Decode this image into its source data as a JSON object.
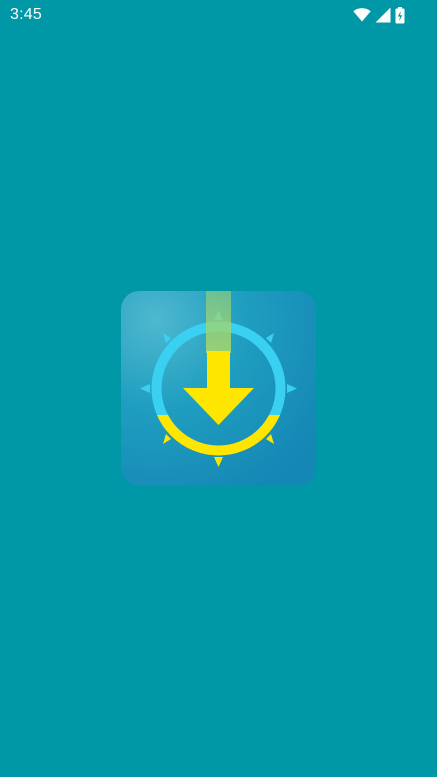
{
  "status_bar": {
    "time": "3:45",
    "icons": [
      "wifi-icon",
      "cellular-signal-icon",
      "battery-charging-icon"
    ]
  },
  "splash": {
    "logo_icon": "download-arrow-gear-logo",
    "colors": {
      "background": "#0097a7",
      "logo_tile": "#1aa3c0",
      "gear_ring": "#3ad0f2",
      "arrow": "#ffe600",
      "beam": "#9ccc65"
    }
  }
}
